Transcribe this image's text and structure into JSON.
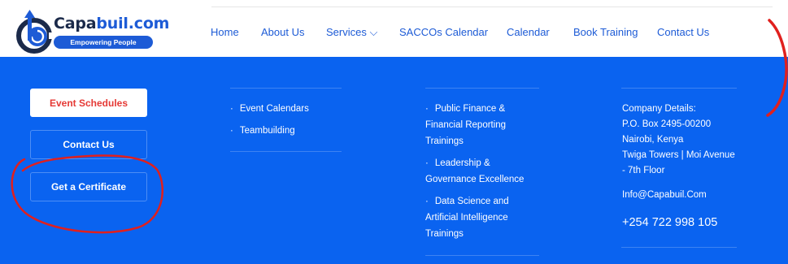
{
  "logo": {
    "title_part1": "Capa",
    "title_part2": "buil.com",
    "tagline": "Empowering People"
  },
  "nav": {
    "items": [
      "Home",
      "About Us",
      "Services ⌵",
      "SACCOs Calendar",
      "Calendar",
      "Book Training",
      "Contact Us"
    ]
  },
  "footer": {
    "buttons": {
      "event_schedules": "Event Schedules",
      "contact_us": "Contact Us",
      "get_certificate": "Get a Certificate"
    },
    "col2": [
      "Event Calendars",
      "Teambuilding"
    ],
    "col3": [
      "Public Finance &",
      "Financial Reporting",
      "Trainings",
      "Leadership &",
      "Governance Excellence",
      "Data Science and",
      "Artificial Intelligence",
      "Trainings"
    ],
    "bullet": "·",
    "company": {
      "heading": "Company Details:",
      "address1": "P.O. Box 2495-00200",
      "address2": "Nairobi, Kenya",
      "address3": "Twiga Towers | Moi Avenue",
      "address4": "- 7th Floor",
      "email": "Info@Capabuil.Com",
      "phone": "+254 722 998 105"
    }
  },
  "colors": {
    "brand_blue": "#0a63f0",
    "nav_blue": "#1d5bd6",
    "dark_navy": "#1b2a4a",
    "accent_red": "#e53935"
  }
}
